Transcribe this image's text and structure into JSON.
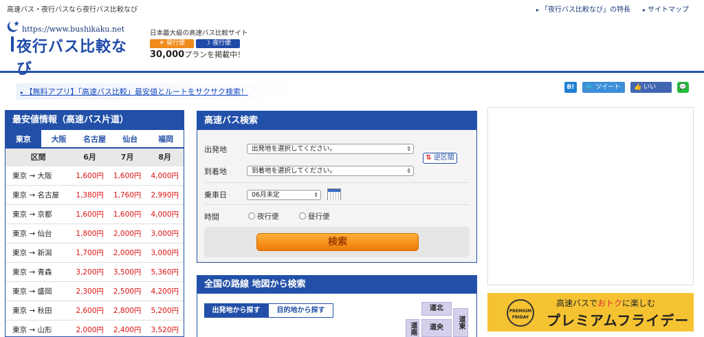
{
  "header": {
    "tagline": "高速バス・夜行バスなら夜行バス比較なび",
    "links": [
      "「夜行バス比較なび」の特長",
      "サイトマップ"
    ],
    "logo_url": "https://www.bushikaku.net",
    "logo_name": "夜行バス比較なび",
    "sub_title": "日本最大級の高速バス比較サイト",
    "badge_day": "昼行便",
    "badge_night": "夜行便",
    "plan_count": "30,000",
    "plan_suffix": "プランを掲載中！"
  },
  "promo": {
    "text": "【無料アプリ】「高速バス比較」最安値とルートをサクサク検索！"
  },
  "social": {
    "hatena": "B!",
    "tweet": "ツイート",
    "like": "いいね！",
    "line": "LINE"
  },
  "price_panel": {
    "title": "最安値情報（高速バス片道）",
    "tabs": [
      "東京",
      "大阪",
      "名古屋",
      "仙台",
      "福岡"
    ],
    "active_tab": "東京",
    "columns": [
      "区間",
      "6月",
      "7月",
      "8月"
    ],
    "rows": [
      {
        "route": "東京 → 大阪",
        "jun": "1,600円",
        "jul": "1,600円",
        "aug": "4,000円"
      },
      {
        "route": "東京 → 名古屋",
        "jun": "1,380円",
        "jul": "1,760円",
        "aug": "2,990円"
      },
      {
        "route": "東京 → 京都",
        "jun": "1,600円",
        "jul": "1,600円",
        "aug": "4,000円"
      },
      {
        "route": "東京 → 仙台",
        "jun": "1,800円",
        "jul": "2,000円",
        "aug": "3,000円"
      },
      {
        "route": "東京 → 新潟",
        "jun": "1,700円",
        "jul": "2,000円",
        "aug": "3,000円"
      },
      {
        "route": "東京 → 青森",
        "jun": "3,200円",
        "jul": "3,500円",
        "aug": "5,360円"
      },
      {
        "route": "東京 → 盛岡",
        "jun": "2,300円",
        "jul": "2,500円",
        "aug": "4,200円"
      },
      {
        "route": "東京 → 秋田",
        "jun": "2,600円",
        "jul": "2,800円",
        "aug": "5,200円"
      },
      {
        "route": "東京 → 山形",
        "jun": "2,000円",
        "jul": "2,400円",
        "aug": "3,520円"
      }
    ]
  },
  "search": {
    "title": "高速バス検索",
    "from_label": "出発地",
    "from_value": "出発地を選択してください。",
    "to_label": "到着地",
    "to_value": "到着地を選択してください。",
    "reverse": "逆区間",
    "date_label": "乗車日",
    "date_value": "06月未定",
    "time_label": "時間",
    "opt_night": "夜行便",
    "opt_day": "昼行便",
    "button": "検索"
  },
  "map": {
    "title": "全国の路線 地図から検索",
    "tab_from": "出発地から探す",
    "tab_to": "目的地から探す",
    "regions": [
      "道北",
      "道央",
      "道東",
      "道南"
    ]
  },
  "ad": {
    "badge": "PREMIUM FRIDAY",
    "line1_a": "高速バスで",
    "line1_hl": "おトク",
    "line1_b": "に楽しむ",
    "line2": "プレミアムフライデー"
  },
  "colors": {
    "brand": "#2250a8",
    "price": "#dd1111",
    "button": "#f08a1a"
  }
}
